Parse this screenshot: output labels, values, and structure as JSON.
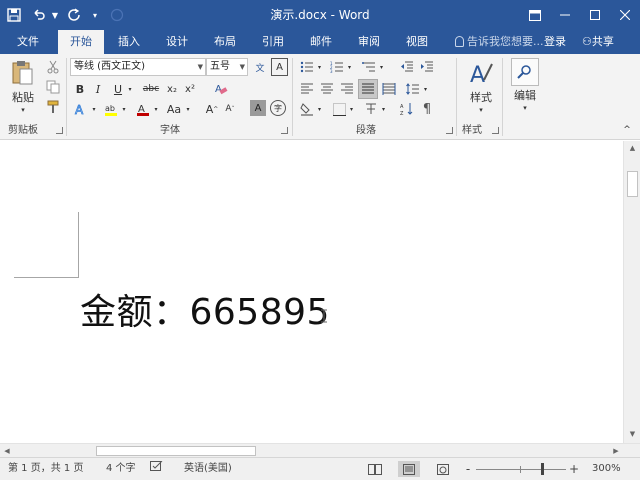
{
  "window": {
    "title": "演示.docx - Word",
    "colors": {
      "brand": "#2b579a",
      "ribbon_bg": "#f3f3f3"
    }
  },
  "qat": {
    "icons": [
      "save-icon",
      "undo-icon",
      "redo-icon",
      "customize-icon"
    ]
  },
  "tabs": [
    {
      "label": "文件",
      "active": false
    },
    {
      "label": "开始",
      "active": true
    },
    {
      "label": "插入",
      "active": false
    },
    {
      "label": "设计",
      "active": false
    },
    {
      "label": "布局",
      "active": false
    },
    {
      "label": "引用",
      "active": false
    },
    {
      "label": "邮件",
      "active": false
    },
    {
      "label": "审阅",
      "active": false
    },
    {
      "label": "视图",
      "active": false
    }
  ],
  "tell_me": "告诉我您想要...",
  "sign_in": "登录",
  "share": "共享",
  "ribbon": {
    "clipboard": {
      "paste_label": "粘贴",
      "group_label": "剪贴板"
    },
    "font": {
      "font_name": "等线 (西文正文)",
      "font_size": "五号",
      "group_label": "字体",
      "bold": "B",
      "italic": "I",
      "underline": "U",
      "strikethrough": "abc",
      "subscript": "x₂",
      "superscript": "x²",
      "font_color_letter": "A",
      "change_case": "Aa",
      "grow_font": "A",
      "shrink_font": "A",
      "char_shading": "A",
      "enclose_char": "字",
      "phonetic": "文",
      "char_border": "A",
      "accent_colors": {
        "highlight": "#ffff00",
        "font_color": "#c00000"
      }
    },
    "paragraph": {
      "group_label": "段落"
    },
    "styles": {
      "label": "样式",
      "group_label": "样式"
    },
    "editing": {
      "label": "编辑"
    }
  },
  "document": {
    "text": "金额：665895"
  },
  "status": {
    "page": "第 1 页，共 1 页",
    "words": "4 个字",
    "language": "英语(美国)",
    "zoom_level": "300%",
    "zoom_minus": "-",
    "zoom_plus": "+"
  }
}
